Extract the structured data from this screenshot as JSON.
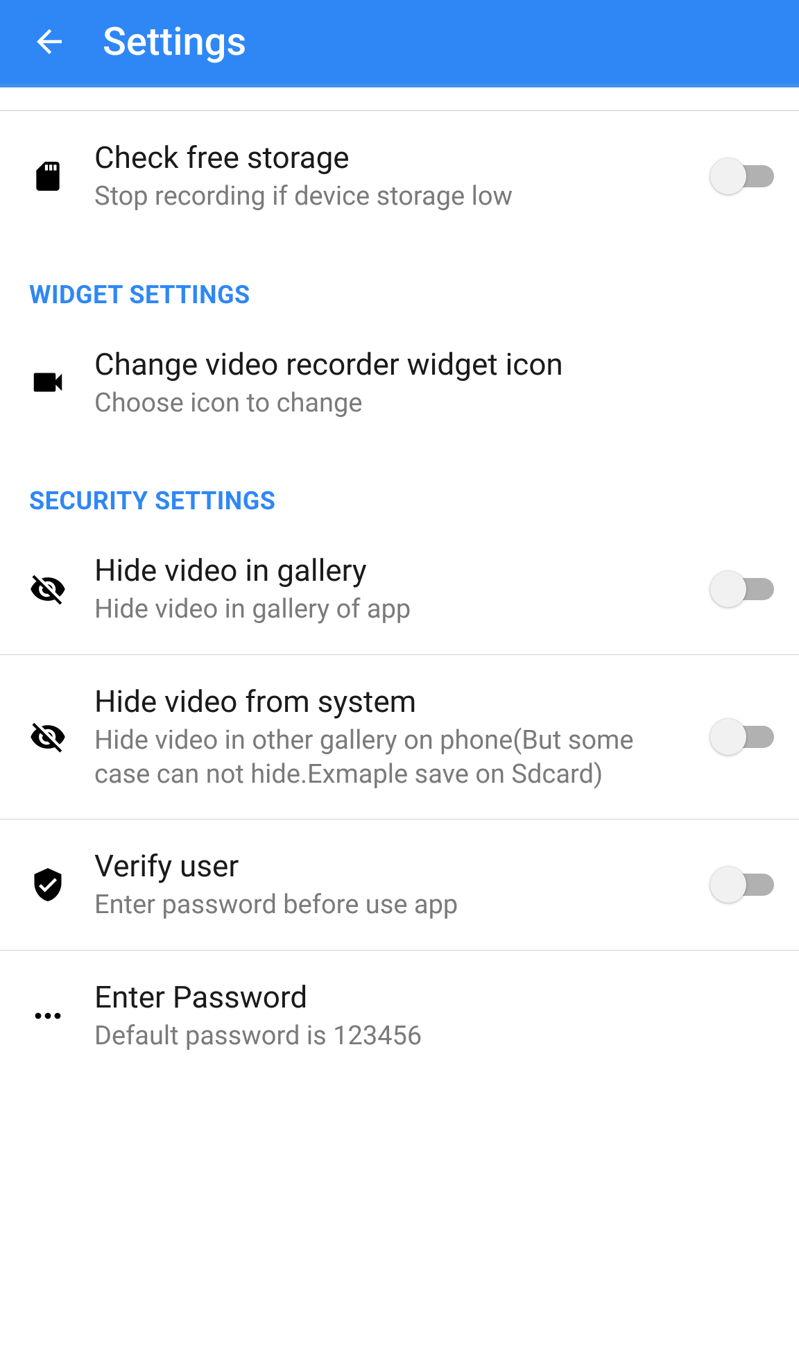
{
  "header": {
    "title": "Settings"
  },
  "rows": {
    "storage": {
      "title": "Check free storage",
      "subtitle": "Stop recording if device storage low"
    },
    "widget_icon": {
      "title": "Change video recorder widget icon",
      "subtitle": "Choose icon to change"
    },
    "hide_gallery": {
      "title": "Hide video in gallery",
      "subtitle": "Hide video in gallery of app"
    },
    "hide_system": {
      "title": "Hide video from system",
      "subtitle": "Hide video in other gallery on phone(But some case can not hide.Exmaple save on Sdcard)"
    },
    "verify_user": {
      "title": "Verify user",
      "subtitle": "Enter password before use app"
    },
    "enter_password": {
      "title": "Enter Password",
      "subtitle": "Default password is 123456"
    }
  },
  "sections": {
    "widget": "WIDGET SETTINGS",
    "security": "SECURITY SETTINGS"
  }
}
